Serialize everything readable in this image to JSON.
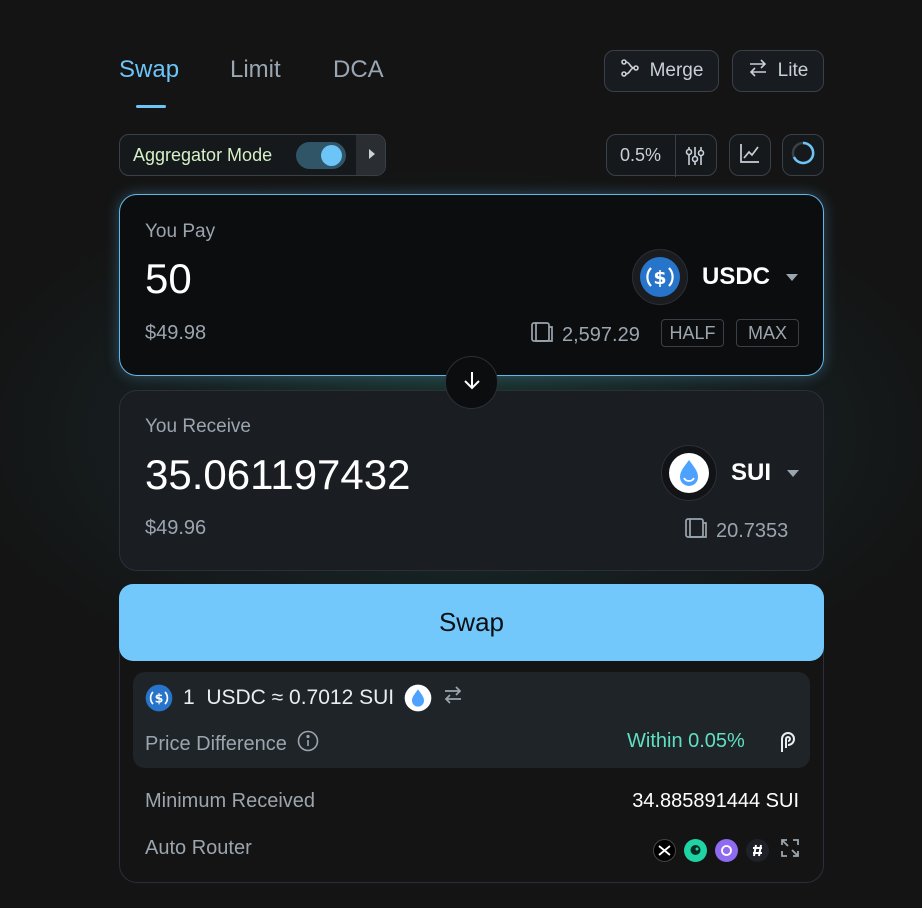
{
  "tabs": [
    {
      "label": "Swap",
      "active": true
    },
    {
      "label": "Limit",
      "active": false
    },
    {
      "label": "DCA",
      "active": false
    }
  ],
  "header_buttons": {
    "merge_label": "Merge",
    "lite_label": "Lite"
  },
  "aggregator": {
    "label": "Aggregator Mode",
    "enabled": true
  },
  "slippage": {
    "value": "0.5%"
  },
  "pay": {
    "label": "You Pay",
    "amount": "50",
    "usd_value": "$49.98",
    "token": "USDC",
    "balance": "2,597.29",
    "half_label": "HALF",
    "max_label": "MAX"
  },
  "receive": {
    "label": "You Receive",
    "amount": "35.061197432",
    "usd_value": "$49.96",
    "token": "SUI",
    "balance": "20.7353"
  },
  "swap_button": {
    "label": "Swap"
  },
  "rate": {
    "text": "1  USDC ≈ 0.7012 SUI"
  },
  "price_difference": {
    "label": "Price Difference",
    "value": "Within 0.05%"
  },
  "minimum_received": {
    "label": "Minimum Received",
    "value": "34.885891444 SUI"
  },
  "auto_router": {
    "label": "Auto Router"
  },
  "colors": {
    "accent": "#6cc4f7",
    "swap_button": "#72c8fa",
    "usdc_blue": "#2775ca",
    "positive": "#5fe0c0"
  }
}
